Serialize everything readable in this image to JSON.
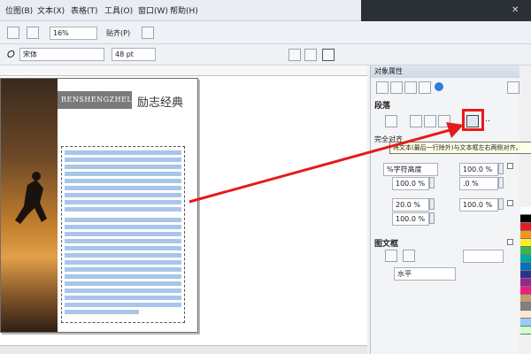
{
  "menubar": {
    "items": [
      "位图(B)",
      "文本(X)",
      "表格(T)",
      "工具(O)",
      "窗口(W)",
      "帮助(H)"
    ]
  },
  "toolbar": {
    "zoom_value": "16%",
    "snap_label": "贴齐(P)",
    "font_name": "宋体",
    "font_size": "48 pt"
  },
  "document": {
    "banner_en": "RENSHENGZHELI",
    "banner_zh": "励志经典"
  },
  "docker": {
    "title": "对象属性",
    "paragraph_section": "段落",
    "selected_alignment_label": "完全对齐",
    "tooltip": "将文本(最后一行除外)与文本框左右两侧对齐。",
    "line_spacing_unit": "%字符高度",
    "fields": [
      "100.0 %",
      "100.0 %",
      ".0 %",
      "20.0 %",
      "100.0 %",
      "100.0 %"
    ],
    "frame_section": "图文框",
    "direction_label": "水平"
  },
  "colors": {
    "accent_red": "#e61a1a",
    "palette": [
      "#ffffff",
      "#000000",
      "#e51e26",
      "#f7931e",
      "#fcee21",
      "#39b54a",
      "#00a99d",
      "#0071bc",
      "#2e3192",
      "#92278f",
      "#ed1e79",
      "#c69c6d",
      "#808080",
      "#ffe6cc",
      "#99ccff",
      "#ccffcc"
    ]
  }
}
